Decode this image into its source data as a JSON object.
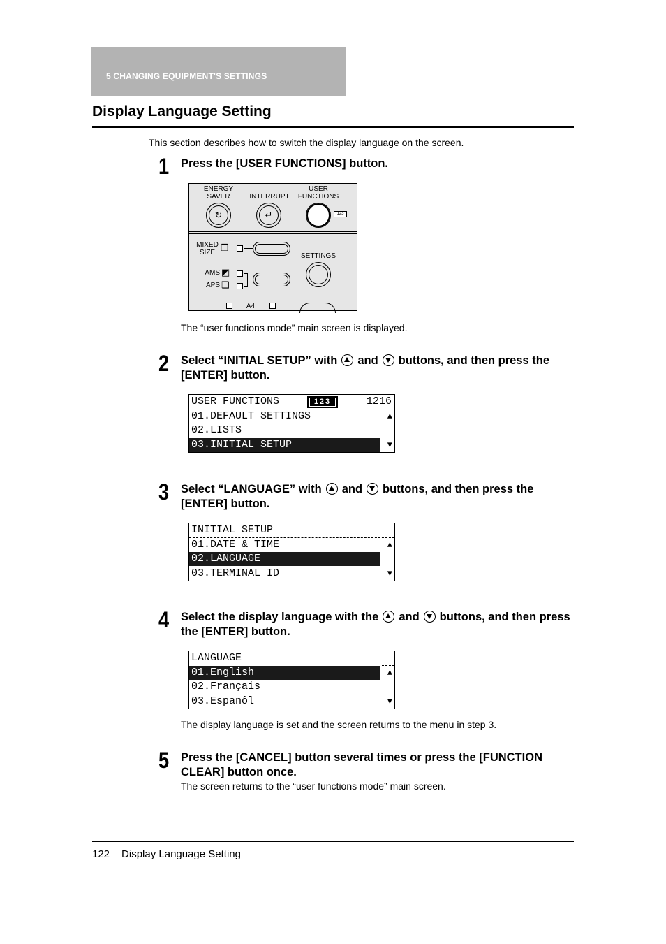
{
  "header": {
    "chapter": "5   CHANGING EQUIPMENT'S SETTINGS"
  },
  "title": "Display Language Setting",
  "intro": "This section describes how to switch the display language on the screen.",
  "steps": [
    {
      "num": "1",
      "text": "Press the [USER FUNCTIONS] button.",
      "note": "The “user functions mode” main screen is displayed."
    },
    {
      "num": "2",
      "pre": "Select “INITIAL SETUP” with",
      "mid": "and",
      "post": "buttons, and then press the [ENTER] button."
    },
    {
      "num": "3",
      "pre": "Select “LANGUAGE” with",
      "mid": "and",
      "post": "buttons, and then press the [ENTER] button."
    },
    {
      "num": "4",
      "pre": "Select the display language with the",
      "mid": "and",
      "post": "buttons, and then press the [ENTER] button.",
      "note": "The display language is set and the screen returns to the menu in step 3."
    },
    {
      "num": "5",
      "text": "Press the [CANCEL] button several times or press the [FUNCTION CLEAR] button once.",
      "note": "The screen returns to the “user functions mode” main screen."
    }
  ],
  "panel": {
    "energy_saver": "ENERGY\nSAVER",
    "interrupt": "INTERRUPT",
    "user_functions": "USER\nFUNCTIONS",
    "counter_badge": "123",
    "mixed_size": "MIXED\nSIZE",
    "ams": "AMS",
    "aps": "APS",
    "settings": "SETTINGS",
    "paper_size": "A4"
  },
  "lcd1": {
    "header": "USER FUNCTIONS",
    "badge": "123",
    "count": "1216",
    "items": [
      "01.DEFAULT SETTINGS",
      "02.LISTS",
      "03.INITIAL SETUP"
    ],
    "selected_index": 2
  },
  "lcd2": {
    "header": "INITIAL SETUP",
    "items": [
      "01.DATE & TIME",
      "02.LANGUAGE",
      "03.TERMINAL ID"
    ],
    "selected_index": 1
  },
  "lcd3": {
    "header": "LANGUAGE",
    "items": [
      "01.English",
      "02.Français",
      "03.Espanôl"
    ],
    "selected_index": 0
  },
  "arrows": {
    "up": "▲",
    "down": "▼"
  },
  "footer": {
    "page": "122",
    "section": "Display Language Setting"
  }
}
